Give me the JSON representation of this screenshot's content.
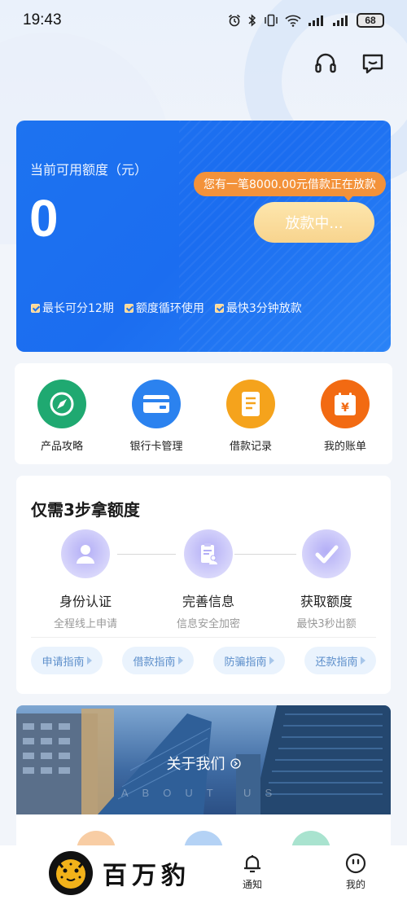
{
  "status_bar": {
    "time": "19:43",
    "battery": "68"
  },
  "header": {
    "support_icon": "headset-icon",
    "message_icon": "chat-bubble-icon"
  },
  "credit_card": {
    "label": "当前可用额度（元）",
    "amount": "0",
    "loan_notice": "您有一笔8000.00元借款正在放款",
    "status_button": "放款中...",
    "features": [
      "最长可分12期",
      "额度循环使用",
      "最快3分钟放款"
    ],
    "colors": {
      "card": "#1d73f0",
      "notice": "#f3923a",
      "button": "#f8d48e"
    }
  },
  "quick_menu": [
    {
      "label": "产品攻略",
      "icon": "compass-icon",
      "color": "#1fa971"
    },
    {
      "label": "银行卡管理",
      "icon": "bank-card-icon",
      "color": "#2b82ef"
    },
    {
      "label": "借款记录",
      "icon": "document-icon",
      "color": "#f5a31c"
    },
    {
      "label": "我的账单",
      "icon": "bill-calendar-icon",
      "color": "#f26a12"
    }
  ],
  "steps": {
    "title": "仅需3步拿额度",
    "items": [
      {
        "name": "身份认证",
        "desc": "全程线上申请",
        "icon": "user-icon"
      },
      {
        "name": "完善信息",
        "desc": "信息安全加密",
        "icon": "clipboard-user-icon"
      },
      {
        "name": "获取额度",
        "desc": "最快3秒出额",
        "icon": "check-icon"
      }
    ],
    "guides": [
      "申请指南",
      "借款指南",
      "防骗指南",
      "还款指南"
    ]
  },
  "about": {
    "title": "关于我们",
    "subtitle": "ABOUT US"
  },
  "tab_bar": {
    "brand_name": "百万豹",
    "tabs": [
      {
        "label": "通知",
        "icon": "bell-icon"
      },
      {
        "label": "我的",
        "icon": "smiley-icon"
      }
    ]
  }
}
